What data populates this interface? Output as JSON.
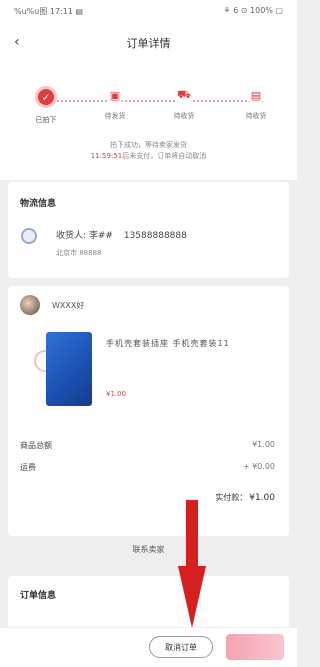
{
  "status_bar": {
    "left": "%u%u图 17:11 ▤",
    "right": "⚘ 6 ⊙ 100% ▢"
  },
  "header": {
    "title": "订单详情"
  },
  "progress": {
    "steps": [
      {
        "label": "已拍下"
      },
      {
        "label": "待发货"
      },
      {
        "label": "待收货"
      },
      {
        "label": "待收货"
      }
    ],
    "note_line1": "拍下成功，等待卖家发货",
    "note_time": "11:59:51",
    "note_line2": "后未支付，订单将自动取消"
  },
  "address": {
    "title": "物流信息",
    "recipient_label": "收货人: 李##",
    "phone": "13588888888",
    "address_line": "北京市 88888"
  },
  "goods": {
    "shop_name": "WXXX好",
    "product_name": "手机壳套装插座 手机壳套装11",
    "product_price": "¥1.00",
    "subtotal_label": "商品总额",
    "subtotal_value": "¥1.00",
    "shipping_label": "运费",
    "shipping_value": "+ ¥0.00",
    "total_label": "实付款：",
    "total_value": "¥1.00",
    "more_label": "联系卖家"
  },
  "order_info": {
    "title": "订单信息"
  },
  "bottom": {
    "cancel_label": "取消订单",
    "pay_label": ""
  },
  "colors": {
    "accent": "#e23b3b",
    "arrow": "#d61f1f"
  }
}
